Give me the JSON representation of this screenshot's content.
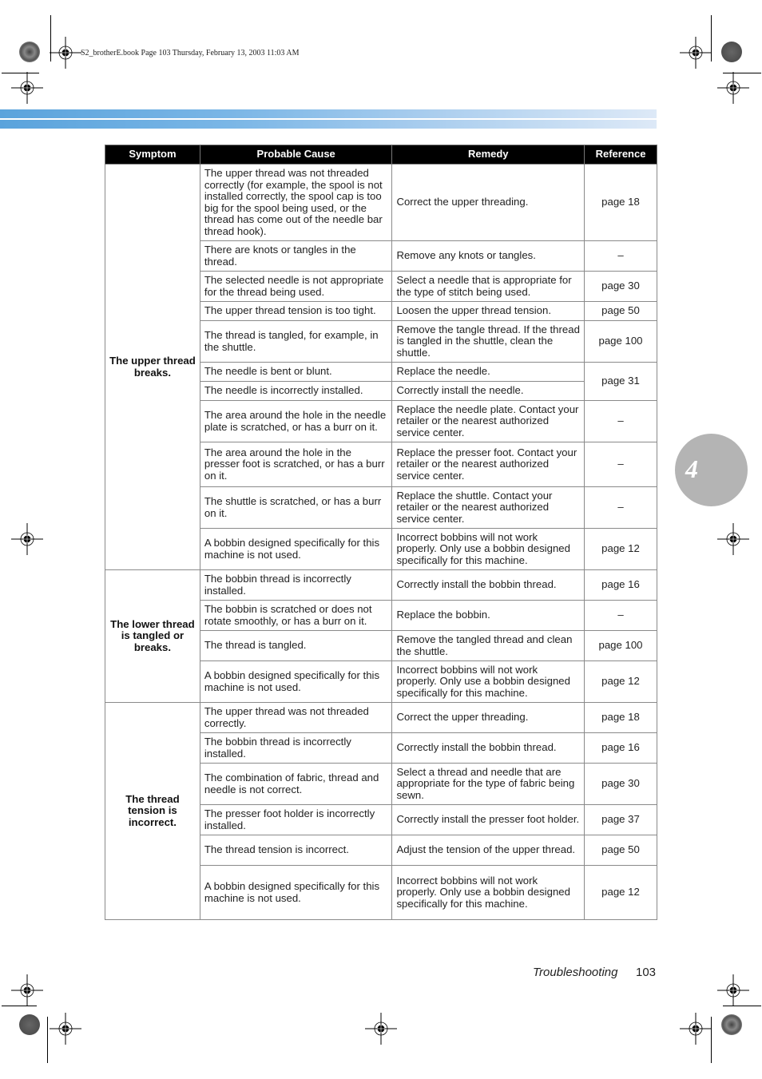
{
  "print_header": "S2_brotherE.book  Page 103  Thursday, February 13, 2003  11:03 AM",
  "chapter_number": "4",
  "table": {
    "headers": [
      "Symptom",
      "Probable Cause",
      "Remedy",
      "Reference"
    ],
    "groups": [
      {
        "symptom": "The upper thread breaks.",
        "rows": [
          {
            "cause": "The upper thread was not threaded correctly (for example, the spool is not installed correctly, the spool cap is too big for the spool being used, or the thread has come out of the needle bar thread hook).",
            "remedy": "Correct the upper threading.",
            "reference": "page 18"
          },
          {
            "cause": "There are knots or tangles in the thread.",
            "remedy": "Remove any knots or tangles.",
            "reference": "–"
          },
          {
            "cause": "The selected needle is not appropriate for the thread being used.",
            "remedy": "Select a needle that is appropriate for the type of stitch being used.",
            "reference": "page 30"
          },
          {
            "cause": "The upper thread tension is too tight.",
            "remedy": "Loosen the upper thread tension.",
            "reference": "page 50"
          },
          {
            "cause": "The thread is tangled, for example, in the shuttle.",
            "remedy": "Remove the tangle thread. If the thread is tangled in the shuttle, clean the shuttle.",
            "reference": "page 100"
          },
          {
            "cause": "The needle is bent or blunt.",
            "remedy": "Replace the needle.",
            "reference": "page 31"
          },
          {
            "cause": "The needle is incorrectly installed.",
            "remedy": "Correctly install the needle.",
            "reference": "page 31"
          },
          {
            "cause": "The area around the hole in the needle plate is scratched, or has a burr on it.",
            "remedy": "Replace the needle plate. Contact your retailer or the nearest authorized service center.",
            "reference": "–"
          },
          {
            "cause": "The area around the hole in the presser foot is scratched, or has a burr on it.",
            "remedy": "Replace the presser foot. Contact your retailer or the nearest authorized service center.",
            "reference": "–"
          },
          {
            "cause": "The shuttle is scratched, or has a burr on it.",
            "remedy": "Replace the shuttle. Contact your retailer or the nearest authorized service center.",
            "reference": "–"
          },
          {
            "cause": "A bobbin designed specifically for this machine is not used.",
            "remedy": "Incorrect bobbins will not work properly. Only use a bobbin designed specifically for this machine.",
            "reference": "page 12"
          }
        ]
      },
      {
        "symptom": "The lower thread is tangled or breaks.",
        "rows": [
          {
            "cause": "The bobbin thread is incorrectly installed.",
            "remedy": "Correctly install the bobbin thread.",
            "reference": "page 16"
          },
          {
            "cause": "The bobbin is scratched or does not rotate smoothly, or has a burr on it.",
            "remedy": "Replace the bobbin.",
            "reference": "–"
          },
          {
            "cause": "The thread is tangled.",
            "remedy": "Remove the tangled thread and clean the shuttle.",
            "reference": "page 100"
          },
          {
            "cause": "A bobbin designed specifically for this machine is not used.",
            "remedy": "Incorrect bobbins will not work properly. Only use a bobbin designed specifically for this machine.",
            "reference": "page 12"
          }
        ]
      },
      {
        "symptom": "The thread tension is incorrect.",
        "rows": [
          {
            "cause": "The upper thread was not threaded correctly.",
            "remedy": "Correct the upper threading.",
            "reference": "page 18"
          },
          {
            "cause": "The bobbin thread is incorrectly installed.",
            "remedy": "Correctly install the bobbin thread.",
            "reference": "page 16"
          },
          {
            "cause": "The combination of fabric, thread and needle is not correct.",
            "remedy": "Select a thread and needle that are appropriate for the type of fabric being sewn.",
            "reference": "page 30"
          },
          {
            "cause": "The presser foot holder is incorrectly installed.",
            "remedy": "Correctly install the presser foot holder.",
            "reference": "page 37"
          },
          {
            "cause": "The thread tension is incorrect.",
            "remedy": "Adjust the tension of the upper thread.",
            "reference": "page 50"
          },
          {
            "cause": "A bobbin designed specifically for this machine is not used.",
            "remedy": "Incorrect bobbins will not work properly. Only use a bobbin designed specifically for this machine.",
            "reference": "page 12"
          }
        ]
      }
    ]
  },
  "footer": {
    "section_title": "Troubleshooting",
    "page_number": "103"
  }
}
